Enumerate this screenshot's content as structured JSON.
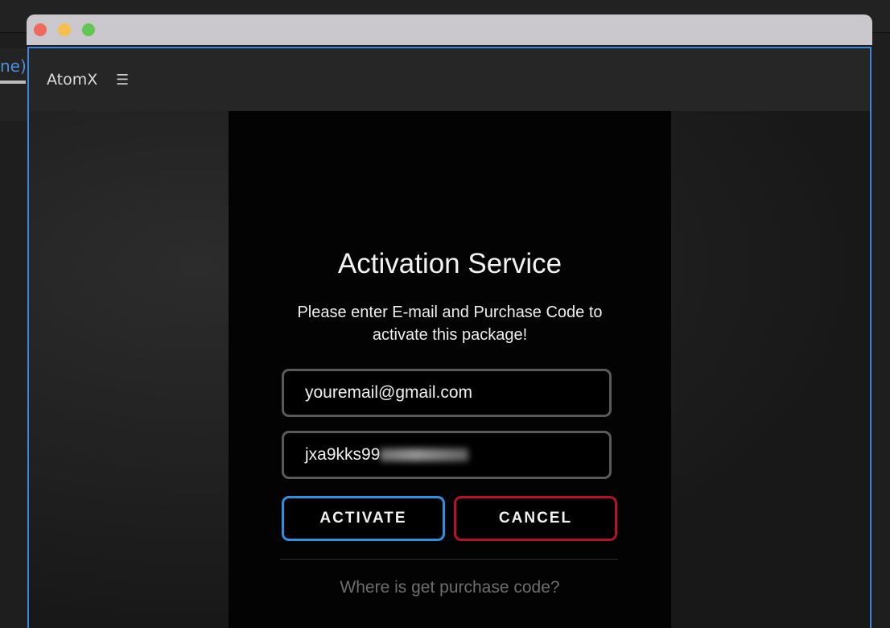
{
  "background": {
    "fragment_text": "ne)"
  },
  "window": {
    "controls": {
      "close_color": "#ee6a5f",
      "minimize_color": "#f5be4f",
      "maximize_color": "#62c554"
    },
    "app_name": "AtomX",
    "menu_icon": "☰"
  },
  "dialog": {
    "title": "Activation Service",
    "subtitle": "Please enter E-mail and Purchase Code to activate this package!",
    "email_value": "youremail@gmail.com",
    "code_value_visible": "jxa9kks99",
    "activate_label": "ACTIVATE",
    "activate_color": "#2f8fe0",
    "cancel_label": "CANCEL",
    "cancel_color": "#b5122a",
    "help_link": "Where is get purchase code?"
  }
}
